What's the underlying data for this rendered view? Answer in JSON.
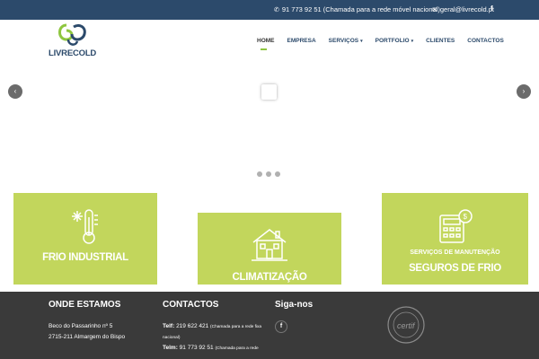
{
  "topbar": {
    "phone_icon": "phone-icon",
    "phone": "91 773 92 51 (Chamada para a rede móvel nacional)",
    "mail_icon": "envelope-icon",
    "email": "geral@livrecold.pt",
    "facebook": "f"
  },
  "header": {
    "logo_text": "LIVRECOLD",
    "nav": [
      {
        "label": "HOME",
        "active": true
      },
      {
        "label": "EMPRESA"
      },
      {
        "label": "SERVIÇOS",
        "chevron": "▾"
      },
      {
        "label": "PORTFOLIO",
        "chevron": "▾"
      },
      {
        "label": "CLIENTES"
      },
      {
        "label": "CONTACTOS"
      }
    ]
  },
  "slider": {
    "prev": "‹",
    "next": "›",
    "dots": 3
  },
  "services": [
    {
      "title": "FRIO INDUSTRIAL",
      "icon": "thermometer-snowflake-icon"
    },
    {
      "title": "CLIMATIZAÇÃO",
      "icon": "house-icon"
    },
    {
      "subtitle": "SERVIÇOS DE MANUTENÇÃO",
      "title": "SEGUROS DE FRIO",
      "icon": "calculator-coin-icon"
    }
  ],
  "footer": {
    "onde_title": "ONDE ESTAMOS",
    "address1": "Beco do Passarinho nº 5",
    "address2": "2715-211 Almargem do Bispo",
    "contactos_title": "CONTACTOS",
    "telf_label": "Telf:",
    "telf": "219 622 421",
    "telf_note": "(Chamada para a rede fixa",
    "telf_note2": "nacional)",
    "telm_label": "Telm:",
    "telm": "91 773 92 51",
    "telm_note": "(Chamada para a rede",
    "siga_title": "Siga-nos",
    "facebook": "f",
    "badge_text": "certif"
  },
  "colors": {
    "topbar": "#2c4a6b",
    "green": "#c2d65c",
    "footer": "#3a3a3a",
    "accent": "#8ec63f"
  }
}
